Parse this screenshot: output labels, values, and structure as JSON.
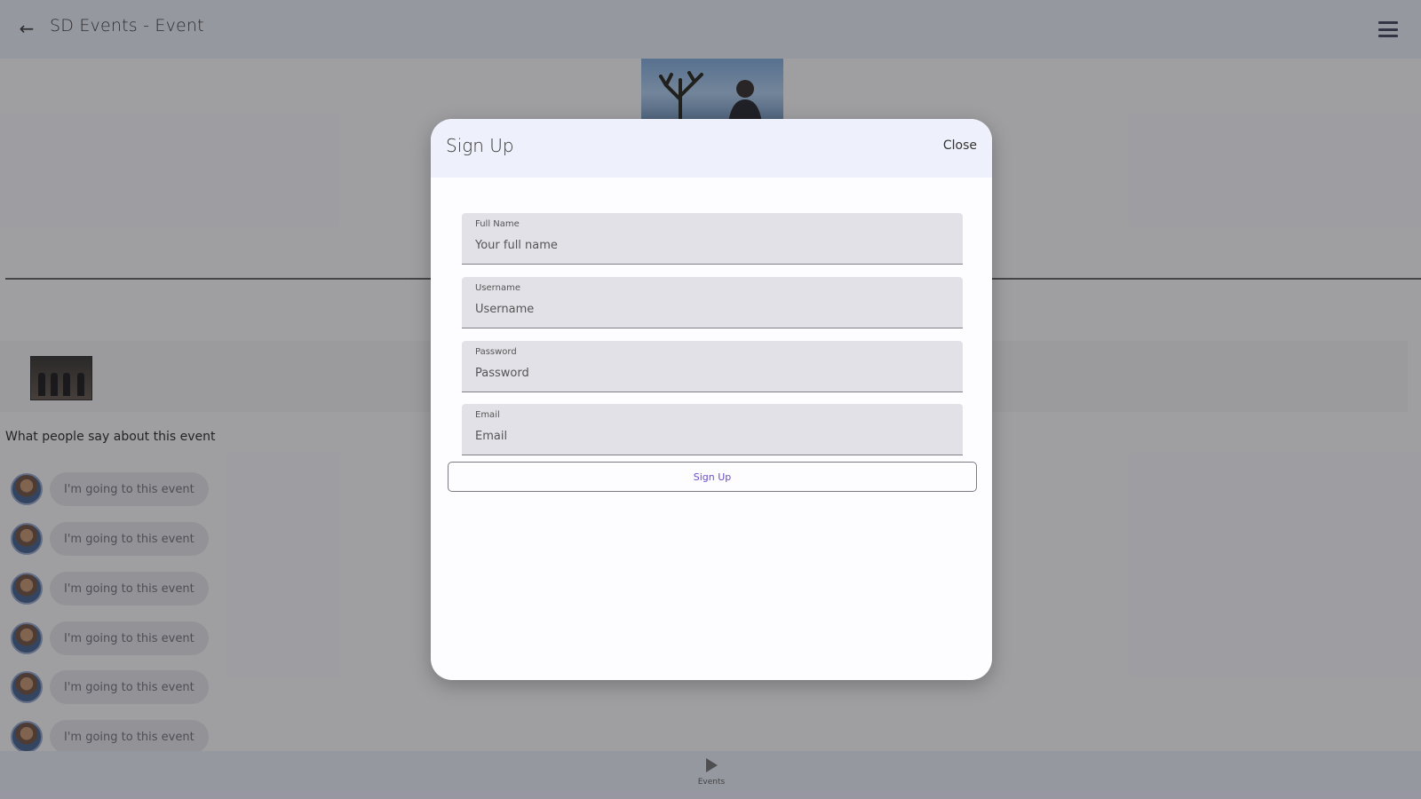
{
  "app": {
    "title": "SD Events - Event"
  },
  "icons": {
    "back": "arrow-left-icon",
    "menu": "list-icon",
    "nav_events": "play-icon"
  },
  "reviews": {
    "title": "What people say about this event",
    "items": [
      {
        "text": "I'm going to this event"
      },
      {
        "text": "I'm going to this event"
      },
      {
        "text": "I'm going to this event"
      },
      {
        "text": "I'm going to this event"
      },
      {
        "text": "I'm going to this event"
      },
      {
        "text": "I'm going to this event"
      }
    ]
  },
  "bottom_nav": {
    "events_label": "Events"
  },
  "modal": {
    "title": "Sign Up",
    "close_label": "Close",
    "fields": {
      "full_name": {
        "label": "Full Name",
        "placeholder": "Your full name"
      },
      "username": {
        "label": "Username",
        "placeholder": "Username"
      },
      "password": {
        "label": "Password",
        "placeholder": "Password"
      },
      "email": {
        "label": "Email",
        "placeholder": "Email"
      }
    },
    "submit_label": "Sign Up"
  },
  "colors": {
    "accent": "#6a4fc9",
    "header_bg": "#e5e8f3",
    "modal_header_bg": "#eef1fb",
    "field_bg": "#e2e1e7"
  }
}
